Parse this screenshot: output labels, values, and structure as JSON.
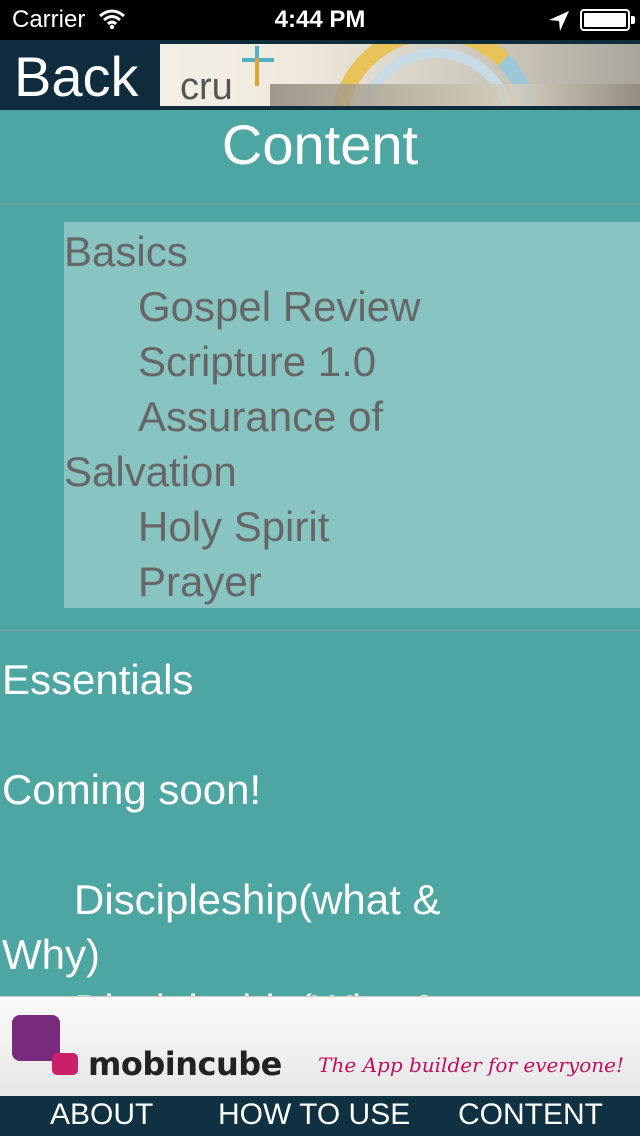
{
  "status_bar": {
    "carrier": "Carrier",
    "time": "4:44 PM",
    "icons": [
      "wifi-icon",
      "location-arrow-icon",
      "battery-icon"
    ]
  },
  "nav": {
    "back_label": "Back",
    "banner_logo_text": "cru"
  },
  "page_title": "Content",
  "basics": {
    "heading": "Basics",
    "items": [
      "Gospel Review",
      "Scripture 1.0",
      "Assurance of",
      "Salvation",
      "Holy Spirit",
      "Prayer"
    ]
  },
  "essentials": {
    "heading": "Essentials",
    "note": "Coming soon!",
    "items": [
      "Discipleship(what &",
      "Why)",
      "Discipleship(Who &"
    ]
  },
  "ad": {
    "brand": "mobincube",
    "tagline": "The App builder for everyone!",
    "colors": {
      "logo_purple": "#7a2a7d",
      "logo_pink": "#cc1f6a",
      "tagline": "#c0105a"
    }
  },
  "tabs": [
    "ABOUT",
    "HOW TO USE",
    "CONTENT"
  ],
  "colors": {
    "nav_background": "#0e2c3c",
    "page_background": "#4ea6a3",
    "tab_bar": "#0f3142"
  }
}
